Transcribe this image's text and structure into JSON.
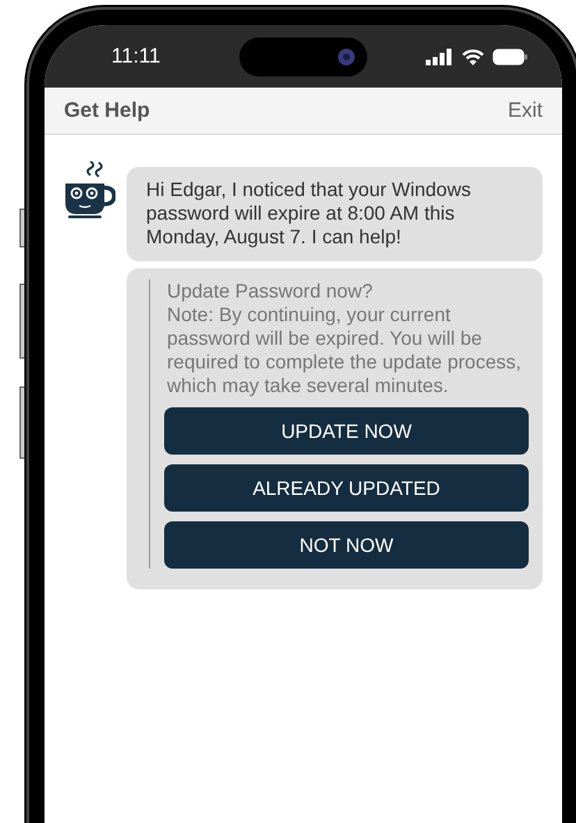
{
  "status_bar": {
    "time": "11:11"
  },
  "header": {
    "title": "Get Help",
    "action": "Exit"
  },
  "messages": [
    {
      "kind": "text",
      "text": "Hi Edgar, I noticed that your Windows password will expire at 8:00 AM this Monday, August 7. I can help!"
    },
    {
      "kind": "prompt",
      "title": "Update Password now?",
      "note": "Note: By continuing, your current password will be expired. You will be required to complete the update process, which may take several minutes.",
      "buttons": [
        "UPDATE NOW",
        "ALREADY UPDATED",
        "NOT NOW"
      ]
    }
  ]
}
